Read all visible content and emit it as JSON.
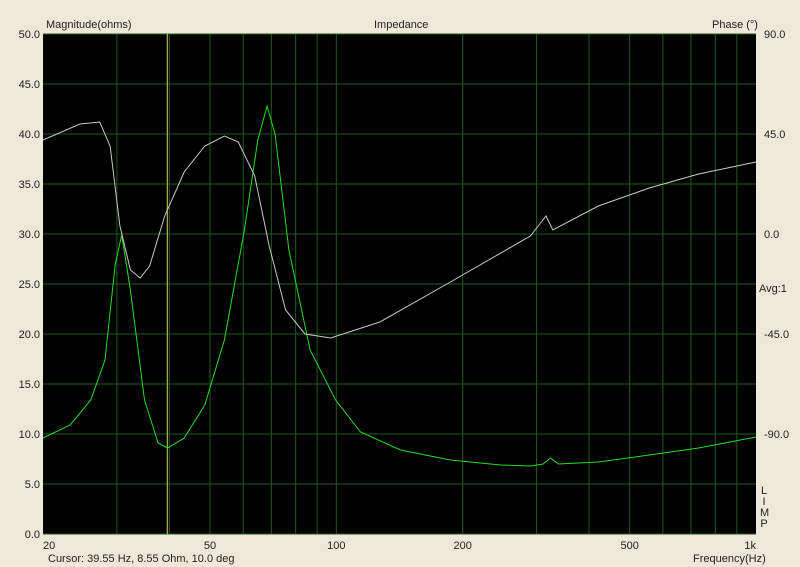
{
  "chart_data": {
    "type": "line",
    "title": "Impedance",
    "ylabel": "Magnitude(ohms)",
    "y2label": "Phase (°)",
    "xlabel": "Frequency(Hz)",
    "xscale": "log",
    "xlim": [
      20,
      1000
    ],
    "ylim": [
      0,
      50
    ],
    "y2lim": [
      -135,
      90
    ],
    "grid": true,
    "x_ticks": [
      {
        "v": 20,
        "label": "20"
      },
      {
        "v": 50,
        "label": "50"
      },
      {
        "v": 100,
        "label": "100"
      },
      {
        "v": 200,
        "label": "200"
      },
      {
        "v": 500,
        "label": "500"
      },
      {
        "v": 1000,
        "label": "1k"
      }
    ],
    "x_gridlines": [
      30,
      40,
      50,
      60,
      70,
      80,
      90,
      100,
      200,
      300,
      400,
      500,
      600,
      700,
      800,
      900
    ],
    "y_ticks": [
      "50.0",
      "45.0",
      "40.0",
      "35.0",
      "30.0",
      "25.0",
      "20.0",
      "15.0",
      "10.0",
      "5.0",
      "0.0"
    ],
    "y2_ticks": [
      {
        "v": 90,
        "label": "90.0"
      },
      {
        "v": 45,
        "label": "45.0"
      },
      {
        "v": 0,
        "label": "0.0"
      },
      {
        "v": -45,
        "label": "-45.0"
      },
      {
        "v": -90,
        "label": "-90.0"
      }
    ],
    "series": [
      {
        "name": "Magnitude",
        "axis": "left",
        "color": "#22dd22",
        "x": [
          20,
          23.2,
          26,
          28.1,
          29.7,
          30.8,
          32.3,
          34.9,
          37.6,
          39.6,
          43.4,
          48.6,
          54.1,
          60.4,
          65,
          68.4,
          71.5,
          77.1,
          86.6,
          99.6,
          114.2,
          142.2,
          186.9,
          246,
          290,
          311,
          324,
          338,
          421,
          557,
          730,
          1000
        ],
        "y": [
          9.6,
          10.9,
          13.4,
          17.4,
          26.9,
          29.9,
          24.4,
          13.4,
          9.1,
          8.6,
          9.6,
          12.9,
          19.4,
          30.4,
          39.4,
          42.8,
          39.9,
          28.4,
          18.4,
          13.4,
          10.2,
          8.4,
          7.4,
          6.9,
          6.8,
          7.0,
          7.6,
          7.0,
          7.2,
          7.9,
          8.6,
          9.7
        ]
      },
      {
        "name": "Phase",
        "axis": "right",
        "color": "#c8c8c8",
        "x": [
          20,
          24.5,
          27.3,
          28.9,
          30.5,
          32.3,
          34.1,
          35.9,
          39,
          43.4,
          48.6,
          54.1,
          58.4,
          63.9,
          69.2,
          75.7,
          84.2,
          96.9,
          127,
          187,
          290,
          316,
          328,
          421,
          557,
          730,
          1000
        ],
        "y": [
          42.3,
          49.5,
          50.4,
          39.6,
          3.6,
          -16.2,
          -19.8,
          -14.4,
          8.1,
          27.9,
          39.6,
          44.1,
          41.4,
          26.1,
          -5.4,
          -34.2,
          -45,
          -46.8,
          -39.6,
          -21.6,
          -0.9,
          8.1,
          1.8,
          12.6,
          20.7,
          27,
          32.4
        ]
      }
    ],
    "cursor": {
      "frequency_hz": 39.55,
      "color": "#d8d860"
    }
  },
  "cursor_text": "Cursor: 39.55 Hz, 8.55 Ohm, 10.0 deg",
  "avg_text": "Avg:1",
  "brand_letters": [
    "L",
    "I",
    "M",
    "P"
  ]
}
